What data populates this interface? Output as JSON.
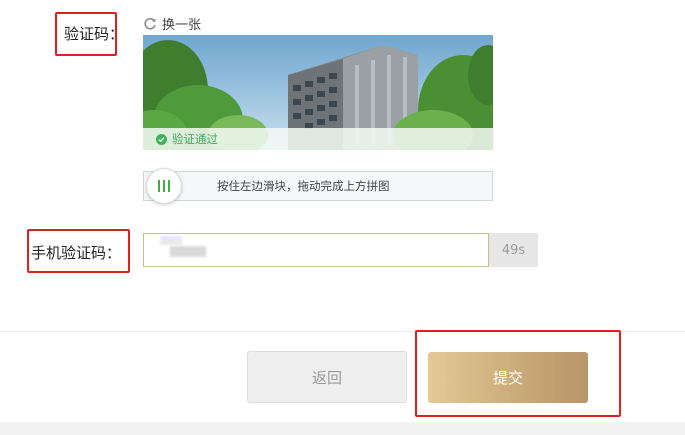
{
  "captcha": {
    "label": "验证码：",
    "refresh_label": "换一张",
    "verified_text": "验证通过",
    "slider_hint": "按住左边滑块，拖动完成上方拼图"
  },
  "sms": {
    "label": "手机验证码：",
    "countdown": "49s"
  },
  "actions": {
    "back_label": "返回",
    "submit_label": "提交"
  },
  "colors": {
    "annotation": "#e02020",
    "success": "#3cb55a",
    "submit_gradient_start": "#e4c999",
    "submit_gradient_end": "#b9956a"
  }
}
